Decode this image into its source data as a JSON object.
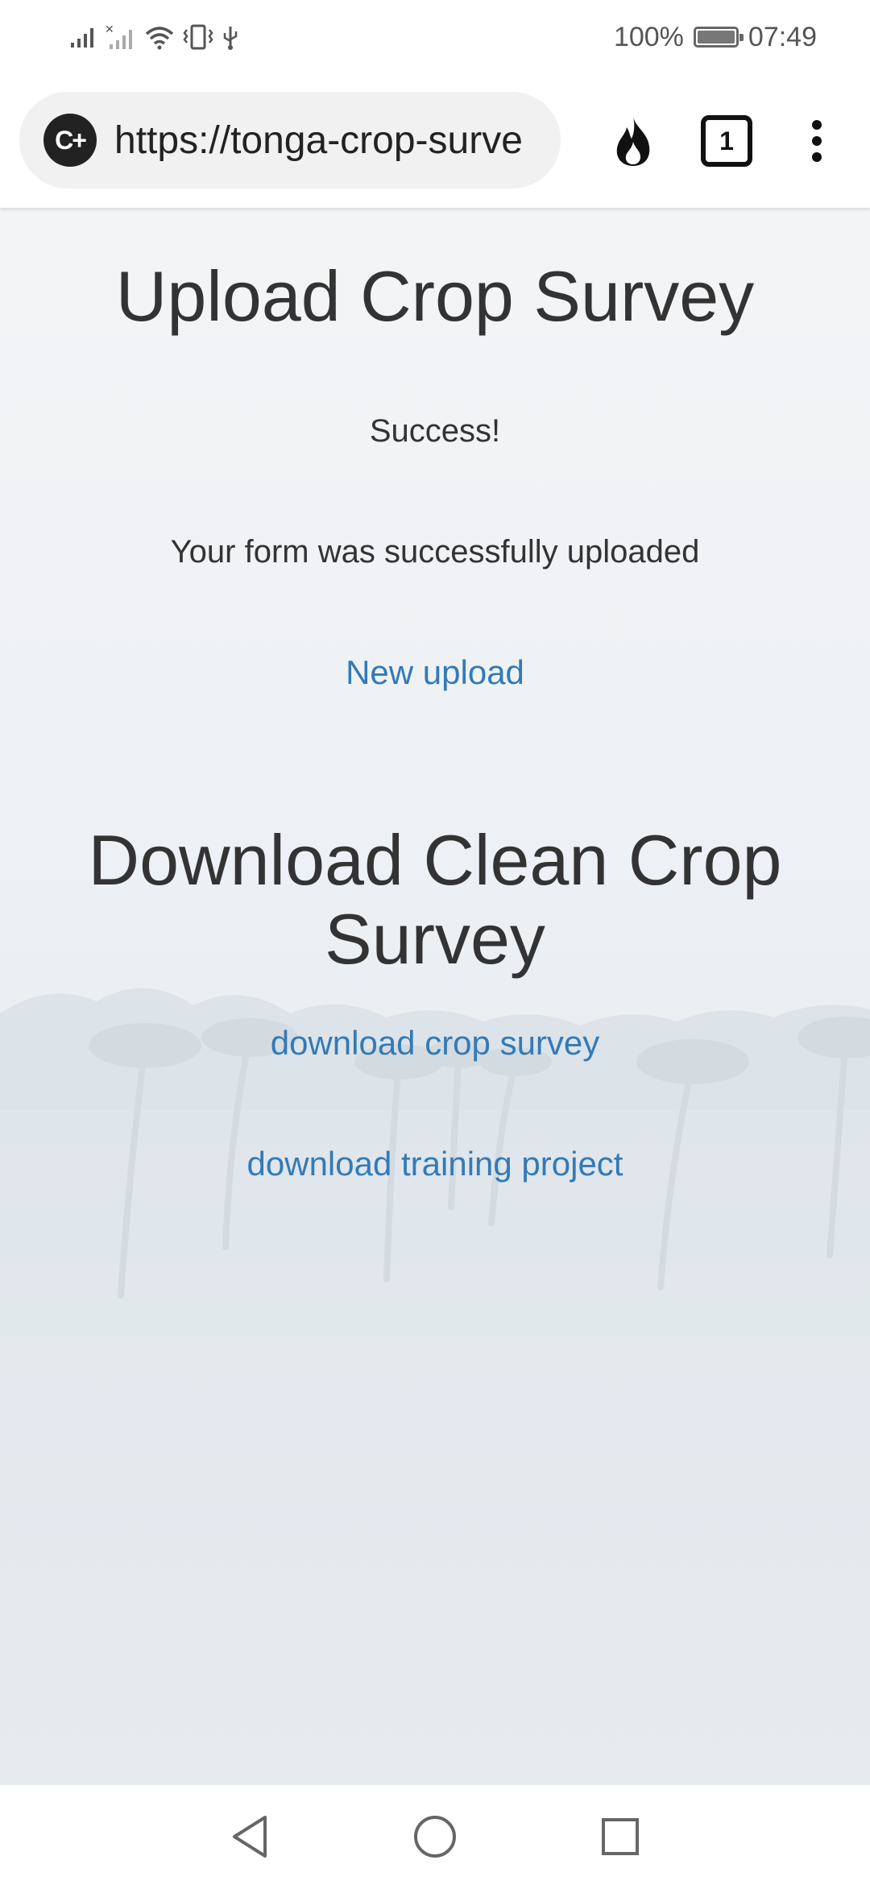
{
  "status_bar": {
    "battery_percent_text": "100%",
    "battery_level": 1.0,
    "time": "07:49",
    "icons": [
      "signal-icon",
      "no-signal-icon",
      "wifi-icon",
      "vibrate-icon",
      "usb-icon",
      "battery-icon"
    ]
  },
  "browser": {
    "url": "https://tonga-crop-survey",
    "site_badge": "C+",
    "tab_count": "1",
    "icons": [
      "site-settings-icon",
      "fire-icon",
      "tab-switcher-icon",
      "more-menu-icon"
    ]
  },
  "page": {
    "upload_heading": "Upload Crop Survey",
    "success_text": "Success!",
    "success_message": "Your form was successfully uploaded",
    "new_upload_link": "New upload",
    "download_heading_line1": "Download Clean Crop",
    "download_heading_line2": "Survey",
    "download_survey_link": "download crop survey",
    "download_training_link": "download training project"
  },
  "navigation": {
    "icons": [
      "back-icon",
      "home-icon",
      "recents-icon"
    ]
  },
  "colors": {
    "link": "#337ab7",
    "heading": "#333333",
    "background_tint": "#e9eef2"
  }
}
